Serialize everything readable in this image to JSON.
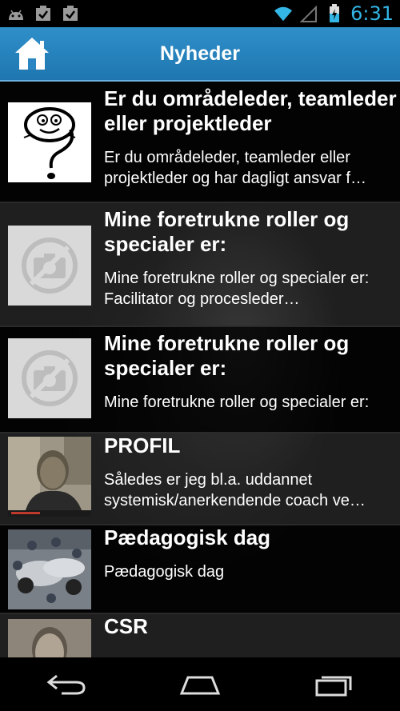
{
  "status": {
    "time": "6:31",
    "icons": [
      "android-icon",
      "checkbox-notification-icon",
      "checkbox-notification-icon",
      "wifi-icon",
      "signal-icon",
      "battery-icon"
    ]
  },
  "header": {
    "title": "Nyheder",
    "home_icon": "home-icon",
    "color": "#2a86c2"
  },
  "news": [
    {
      "title": "Er du områdeleder, teamleder eller projektleder",
      "desc": "Er du områdeleder, teamleder eller projektleder og har dagligt ansvar f…",
      "thumb": "question-mark-figure"
    },
    {
      "title": "Mine foretrukne roller og specialer er:",
      "desc": "Mine foretrukne roller og specialer er: Facilitator og procesleder…",
      "thumb": "no-image-placeholder"
    },
    {
      "title": "Mine foretrukne roller og specialer er:",
      "desc": "Mine foretrukne roller og specialer er:",
      "thumb": "no-image-placeholder"
    },
    {
      "title": "PROFIL",
      "desc": "Således er jeg bl.a. uddannet systemisk/anerkendende coach ve…",
      "thumb": "profile-video-frame"
    },
    {
      "title": "Pædagogisk dag",
      "desc": "Pædagogisk dag",
      "thumb": "pit-stop-photo"
    },
    {
      "title": "CSR",
      "desc": "",
      "thumb": "csr-portrait"
    }
  ],
  "nav": {
    "back_icon": "back-icon",
    "home_icon": "home-outline-icon",
    "recents_icon": "recent-apps-icon"
  },
  "accent": "#33b5e5"
}
